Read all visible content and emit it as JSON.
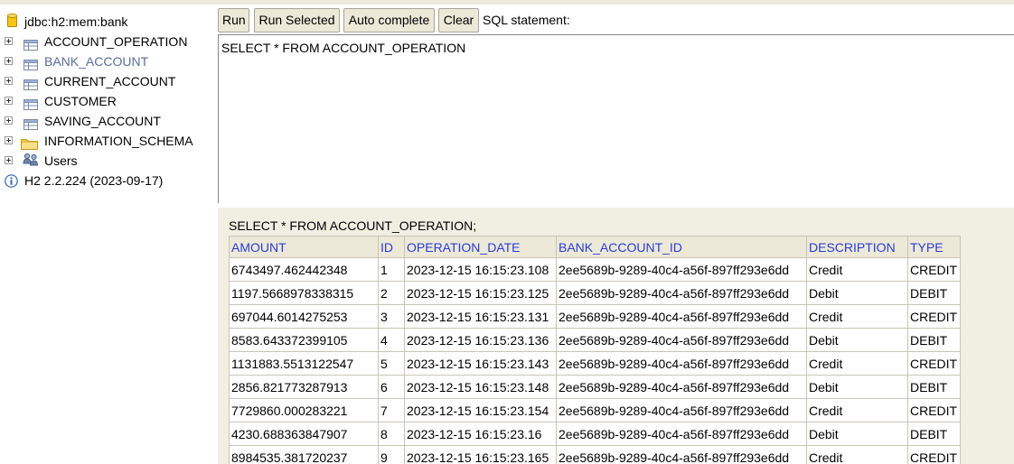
{
  "tree": {
    "connection": "jdbc:h2:mem:bank",
    "items": [
      {
        "label": "ACCOUNT_OPERATION",
        "icon": "table-icon"
      },
      {
        "label": "BANK_ACCOUNT",
        "icon": "table-icon"
      },
      {
        "label": "CURRENT_ACCOUNT",
        "icon": "table-icon"
      },
      {
        "label": "CUSTOMER",
        "icon": "table-icon"
      },
      {
        "label": "SAVING_ACCOUNT",
        "icon": "table-icon"
      },
      {
        "label": "INFORMATION_SCHEMA",
        "icon": "folder-icon"
      },
      {
        "label": "Users",
        "icon": "users-icon"
      }
    ],
    "version": "H2 2.2.224 (2023-09-17)"
  },
  "toolbar": {
    "run": "Run",
    "run_selected": "Run Selected",
    "auto_complete": "Auto complete",
    "clear": "Clear",
    "sql_label": "SQL statement:"
  },
  "editor": {
    "text": "SELECT * FROM ACCOUNT_OPERATION"
  },
  "result": {
    "statement": "SELECT * FROM ACCOUNT_OPERATION;",
    "columns": [
      "AMOUNT",
      "ID",
      "OPERATION_DATE",
      "BANK_ACCOUNT_ID",
      "DESCRIPTION",
      "TYPE"
    ],
    "rows": [
      [
        "6743497.462442348",
        "1",
        "2023-12-15 16:15:23.108",
        "2ee5689b-9289-40c4-a56f-897ff293e6dd",
        "Credit",
        "CREDIT"
      ],
      [
        "1197.5668978338315",
        "2",
        "2023-12-15 16:15:23.125",
        "2ee5689b-9289-40c4-a56f-897ff293e6dd",
        "Debit",
        "DEBIT"
      ],
      [
        "697044.6014275253",
        "3",
        "2023-12-15 16:15:23.131",
        "2ee5689b-9289-40c4-a56f-897ff293e6dd",
        "Credit",
        "CREDIT"
      ],
      [
        "8583.643372399105",
        "4",
        "2023-12-15 16:15:23.136",
        "2ee5689b-9289-40c4-a56f-897ff293e6dd",
        "Debit",
        "DEBIT"
      ],
      [
        "1131883.5513122547",
        "5",
        "2023-12-15 16:15:23.143",
        "2ee5689b-9289-40c4-a56f-897ff293e6dd",
        "Credit",
        "CREDIT"
      ],
      [
        "2856.821773287913",
        "6",
        "2023-12-15 16:15:23.148",
        "2ee5689b-9289-40c4-a56f-897ff293e6dd",
        "Debit",
        "DEBIT"
      ],
      [
        "7729860.000283221",
        "7",
        "2023-12-15 16:15:23.154",
        "2ee5689b-9289-40c4-a56f-897ff293e6dd",
        "Credit",
        "CREDIT"
      ],
      [
        "4230.688363847907",
        "8",
        "2023-12-15 16:15:23.16",
        "2ee5689b-9289-40c4-a56f-897ff293e6dd",
        "Debit",
        "DEBIT"
      ],
      [
        "8984535.381720237",
        "9",
        "2023-12-15 16:15:23.165",
        "2ee5689b-9289-40c4-a56f-897ff293e6dd",
        "Credit",
        "CREDIT"
      ]
    ]
  },
  "colors": {
    "header_link": "#2b3bd6",
    "result_background": "#f1efe2",
    "button_face": "#ece9d8"
  }
}
